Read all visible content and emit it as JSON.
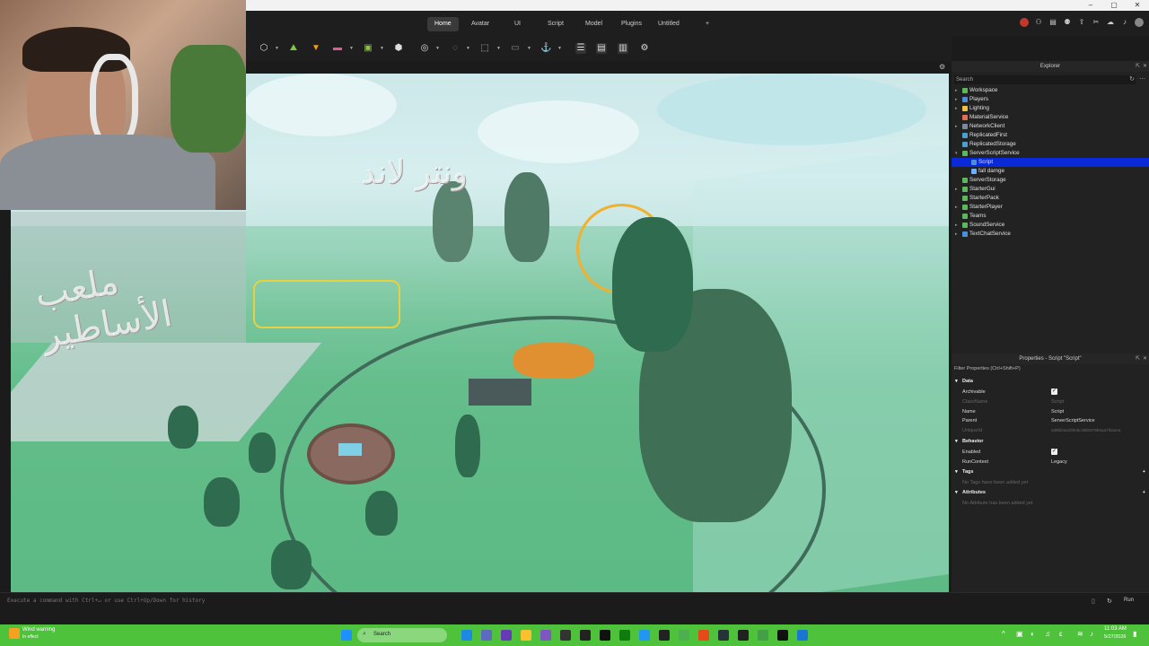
{
  "menu": {
    "tabs": [
      "Home",
      "Avatar",
      "UI",
      "Script",
      "Model",
      "Plugins",
      "Untitled"
    ],
    "add_tab": "+"
  },
  "window": {
    "minimize": "–",
    "maximize": "▢",
    "close": "✕"
  },
  "viewport": {
    "watermark_top": "ونتر لاند",
    "overlay_text": "ملعب الأساطير"
  },
  "explorer": {
    "title": "Explorer",
    "search_placeholder": "Search",
    "items": [
      {
        "label": "Workspace",
        "expandable": true,
        "indent": 0
      },
      {
        "label": "Players",
        "expandable": true,
        "indent": 0
      },
      {
        "label": "Lighting",
        "expandable": true,
        "indent": 0
      },
      {
        "label": "MaterialService",
        "expandable": false,
        "indent": 0
      },
      {
        "label": "NetworkClient",
        "expandable": true,
        "indent": 0
      },
      {
        "label": "ReplicatedFirst",
        "expandable": false,
        "indent": 0
      },
      {
        "label": "ReplicatedStorage",
        "expandable": false,
        "indent": 0
      },
      {
        "label": "ServerScriptService",
        "expandable": true,
        "indent": 0,
        "open": true
      },
      {
        "label": "Script",
        "expandable": false,
        "indent": 1,
        "selected": true
      },
      {
        "label": "fall damge",
        "expandable": false,
        "indent": 1
      },
      {
        "label": "ServerStorage",
        "expandable": false,
        "indent": 0
      },
      {
        "label": "StarterGui",
        "expandable": true,
        "indent": 0
      },
      {
        "label": "StarterPack",
        "expandable": false,
        "indent": 0
      },
      {
        "label": "StarterPlayer",
        "expandable": true,
        "indent": 0
      },
      {
        "label": "Teams",
        "expandable": false,
        "indent": 0
      },
      {
        "label": "SoundService",
        "expandable": true,
        "indent": 0
      },
      {
        "label": "TextChatService",
        "expandable": true,
        "indent": 0
      }
    ]
  },
  "properties": {
    "title": "Properties - Script \"Script\"",
    "filter_placeholder": "Filter Properties (Ctrl+Shift+P)",
    "sections": {
      "data": "Data",
      "behavior": "Behavior",
      "tags": "Tags",
      "attributes": "Attributes"
    },
    "rows": {
      "archivable": "Archivable",
      "classname": "ClassName",
      "classname_value": "Script",
      "name": "Name",
      "name_value": "Script",
      "parent": "Parent",
      "parent_value": "ServerScriptService",
      "uniqueid": "UniqueId",
      "uniqueid_value": "3d9bb4a42f9ebc48b0679b0aa7f0a2ea",
      "enabled": "Enabled",
      "runcontext": "RunContext",
      "runcontext_value": "Legacy"
    },
    "tags_empty": "No Tags have been added yet",
    "attributes_empty": "No Attribute has been added yet"
  },
  "command_bar": {
    "placeholder": "Execute a command with Ctrl+↵ or use Ctrl+Up/Down for history",
    "run": "Run"
  },
  "taskbar": {
    "weather_title": "Wind warning",
    "weather_sub": "In effect",
    "search": "Search",
    "time": "11:03 AM",
    "date": "5/27/2026"
  },
  "colors": {
    "selection": "#0a2ad8",
    "taskbar": "#4ec23a",
    "panel": "#222222"
  }
}
